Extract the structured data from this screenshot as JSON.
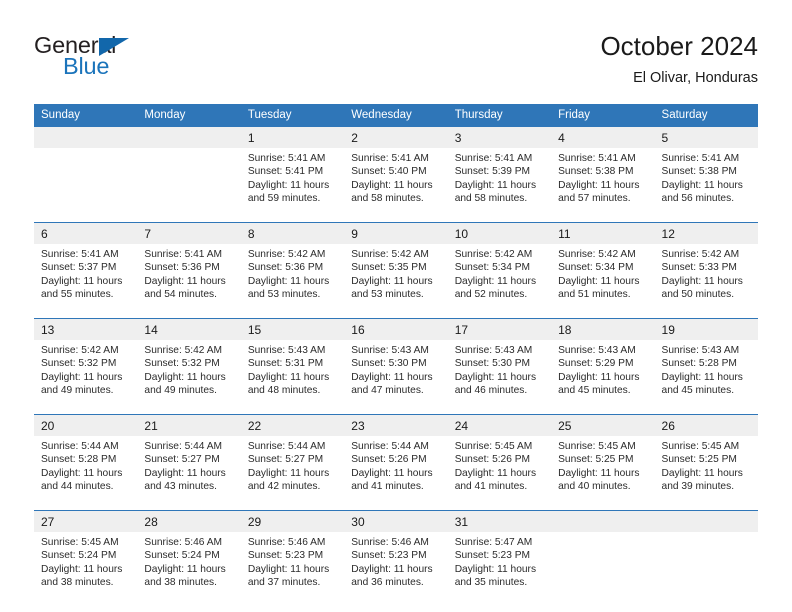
{
  "brand": {
    "name_part1": "General",
    "name_part2": "Blue",
    "accent_color": "#1b74bb",
    "triangle_icon": "blue-triangle-icon"
  },
  "header": {
    "title": "October 2024",
    "subtitle": "El Olivar, Honduras"
  },
  "theme": {
    "header_blue": "#2f76b8",
    "daynum_band": "#efefef",
    "text": "#1a1a1a"
  },
  "weekdays": [
    "Sunday",
    "Monday",
    "Tuesday",
    "Wednesday",
    "Thursday",
    "Friday",
    "Saturday"
  ],
  "weeks": [
    {
      "days": [
        {
          "num": "",
          "empty": true,
          "l1": "",
          "l2": "",
          "l3": "",
          "l4": ""
        },
        {
          "num": "",
          "empty": true,
          "l1": "",
          "l2": "",
          "l3": "",
          "l4": ""
        },
        {
          "num": "1",
          "empty": false,
          "l1": "Sunrise: 5:41 AM",
          "l2": "Sunset: 5:41 PM",
          "l3": "Daylight: 11 hours",
          "l4": "and 59 minutes."
        },
        {
          "num": "2",
          "empty": false,
          "l1": "Sunrise: 5:41 AM",
          "l2": "Sunset: 5:40 PM",
          "l3": "Daylight: 11 hours",
          "l4": "and 58 minutes."
        },
        {
          "num": "3",
          "empty": false,
          "l1": "Sunrise: 5:41 AM",
          "l2": "Sunset: 5:39 PM",
          "l3": "Daylight: 11 hours",
          "l4": "and 58 minutes."
        },
        {
          "num": "4",
          "empty": false,
          "l1": "Sunrise: 5:41 AM",
          "l2": "Sunset: 5:38 PM",
          "l3": "Daylight: 11 hours",
          "l4": "and 57 minutes."
        },
        {
          "num": "5",
          "empty": false,
          "l1": "Sunrise: 5:41 AM",
          "l2": "Sunset: 5:38 PM",
          "l3": "Daylight: 11 hours",
          "l4": "and 56 minutes."
        }
      ]
    },
    {
      "days": [
        {
          "num": "6",
          "empty": false,
          "l1": "Sunrise: 5:41 AM",
          "l2": "Sunset: 5:37 PM",
          "l3": "Daylight: 11 hours",
          "l4": "and 55 minutes."
        },
        {
          "num": "7",
          "empty": false,
          "l1": "Sunrise: 5:41 AM",
          "l2": "Sunset: 5:36 PM",
          "l3": "Daylight: 11 hours",
          "l4": "and 54 minutes."
        },
        {
          "num": "8",
          "empty": false,
          "l1": "Sunrise: 5:42 AM",
          "l2": "Sunset: 5:36 PM",
          "l3": "Daylight: 11 hours",
          "l4": "and 53 minutes."
        },
        {
          "num": "9",
          "empty": false,
          "l1": "Sunrise: 5:42 AM",
          "l2": "Sunset: 5:35 PM",
          "l3": "Daylight: 11 hours",
          "l4": "and 53 minutes."
        },
        {
          "num": "10",
          "empty": false,
          "l1": "Sunrise: 5:42 AM",
          "l2": "Sunset: 5:34 PM",
          "l3": "Daylight: 11 hours",
          "l4": "and 52 minutes."
        },
        {
          "num": "11",
          "empty": false,
          "l1": "Sunrise: 5:42 AM",
          "l2": "Sunset: 5:34 PM",
          "l3": "Daylight: 11 hours",
          "l4": "and 51 minutes."
        },
        {
          "num": "12",
          "empty": false,
          "l1": "Sunrise: 5:42 AM",
          "l2": "Sunset: 5:33 PM",
          "l3": "Daylight: 11 hours",
          "l4": "and 50 minutes."
        }
      ]
    },
    {
      "days": [
        {
          "num": "13",
          "empty": false,
          "l1": "Sunrise: 5:42 AM",
          "l2": "Sunset: 5:32 PM",
          "l3": "Daylight: 11 hours",
          "l4": "and 49 minutes."
        },
        {
          "num": "14",
          "empty": false,
          "l1": "Sunrise: 5:42 AM",
          "l2": "Sunset: 5:32 PM",
          "l3": "Daylight: 11 hours",
          "l4": "and 49 minutes."
        },
        {
          "num": "15",
          "empty": false,
          "l1": "Sunrise: 5:43 AM",
          "l2": "Sunset: 5:31 PM",
          "l3": "Daylight: 11 hours",
          "l4": "and 48 minutes."
        },
        {
          "num": "16",
          "empty": false,
          "l1": "Sunrise: 5:43 AM",
          "l2": "Sunset: 5:30 PM",
          "l3": "Daylight: 11 hours",
          "l4": "and 47 minutes."
        },
        {
          "num": "17",
          "empty": false,
          "l1": "Sunrise: 5:43 AM",
          "l2": "Sunset: 5:30 PM",
          "l3": "Daylight: 11 hours",
          "l4": "and 46 minutes."
        },
        {
          "num": "18",
          "empty": false,
          "l1": "Sunrise: 5:43 AM",
          "l2": "Sunset: 5:29 PM",
          "l3": "Daylight: 11 hours",
          "l4": "and 45 minutes."
        },
        {
          "num": "19",
          "empty": false,
          "l1": "Sunrise: 5:43 AM",
          "l2": "Sunset: 5:28 PM",
          "l3": "Daylight: 11 hours",
          "l4": "and 45 minutes."
        }
      ]
    },
    {
      "days": [
        {
          "num": "20",
          "empty": false,
          "l1": "Sunrise: 5:44 AM",
          "l2": "Sunset: 5:28 PM",
          "l3": "Daylight: 11 hours",
          "l4": "and 44 minutes."
        },
        {
          "num": "21",
          "empty": false,
          "l1": "Sunrise: 5:44 AM",
          "l2": "Sunset: 5:27 PM",
          "l3": "Daylight: 11 hours",
          "l4": "and 43 minutes."
        },
        {
          "num": "22",
          "empty": false,
          "l1": "Sunrise: 5:44 AM",
          "l2": "Sunset: 5:27 PM",
          "l3": "Daylight: 11 hours",
          "l4": "and 42 minutes."
        },
        {
          "num": "23",
          "empty": false,
          "l1": "Sunrise: 5:44 AM",
          "l2": "Sunset: 5:26 PM",
          "l3": "Daylight: 11 hours",
          "l4": "and 41 minutes."
        },
        {
          "num": "24",
          "empty": false,
          "l1": "Sunrise: 5:45 AM",
          "l2": "Sunset: 5:26 PM",
          "l3": "Daylight: 11 hours",
          "l4": "and 41 minutes."
        },
        {
          "num": "25",
          "empty": false,
          "l1": "Sunrise: 5:45 AM",
          "l2": "Sunset: 5:25 PM",
          "l3": "Daylight: 11 hours",
          "l4": "and 40 minutes."
        },
        {
          "num": "26",
          "empty": false,
          "l1": "Sunrise: 5:45 AM",
          "l2": "Sunset: 5:25 PM",
          "l3": "Daylight: 11 hours",
          "l4": "and 39 minutes."
        }
      ]
    },
    {
      "days": [
        {
          "num": "27",
          "empty": false,
          "l1": "Sunrise: 5:45 AM",
          "l2": "Sunset: 5:24 PM",
          "l3": "Daylight: 11 hours",
          "l4": "and 38 minutes."
        },
        {
          "num": "28",
          "empty": false,
          "l1": "Sunrise: 5:46 AM",
          "l2": "Sunset: 5:24 PM",
          "l3": "Daylight: 11 hours",
          "l4": "and 38 minutes."
        },
        {
          "num": "29",
          "empty": false,
          "l1": "Sunrise: 5:46 AM",
          "l2": "Sunset: 5:23 PM",
          "l3": "Daylight: 11 hours",
          "l4": "and 37 minutes."
        },
        {
          "num": "30",
          "empty": false,
          "l1": "Sunrise: 5:46 AM",
          "l2": "Sunset: 5:23 PM",
          "l3": "Daylight: 11 hours",
          "l4": "and 36 minutes."
        },
        {
          "num": "31",
          "empty": false,
          "l1": "Sunrise: 5:47 AM",
          "l2": "Sunset: 5:23 PM",
          "l3": "Daylight: 11 hours",
          "l4": "and 35 minutes."
        },
        {
          "num": "",
          "empty": true,
          "l1": "",
          "l2": "",
          "l3": "",
          "l4": ""
        },
        {
          "num": "",
          "empty": true,
          "l1": "",
          "l2": "",
          "l3": "",
          "l4": ""
        }
      ]
    }
  ]
}
